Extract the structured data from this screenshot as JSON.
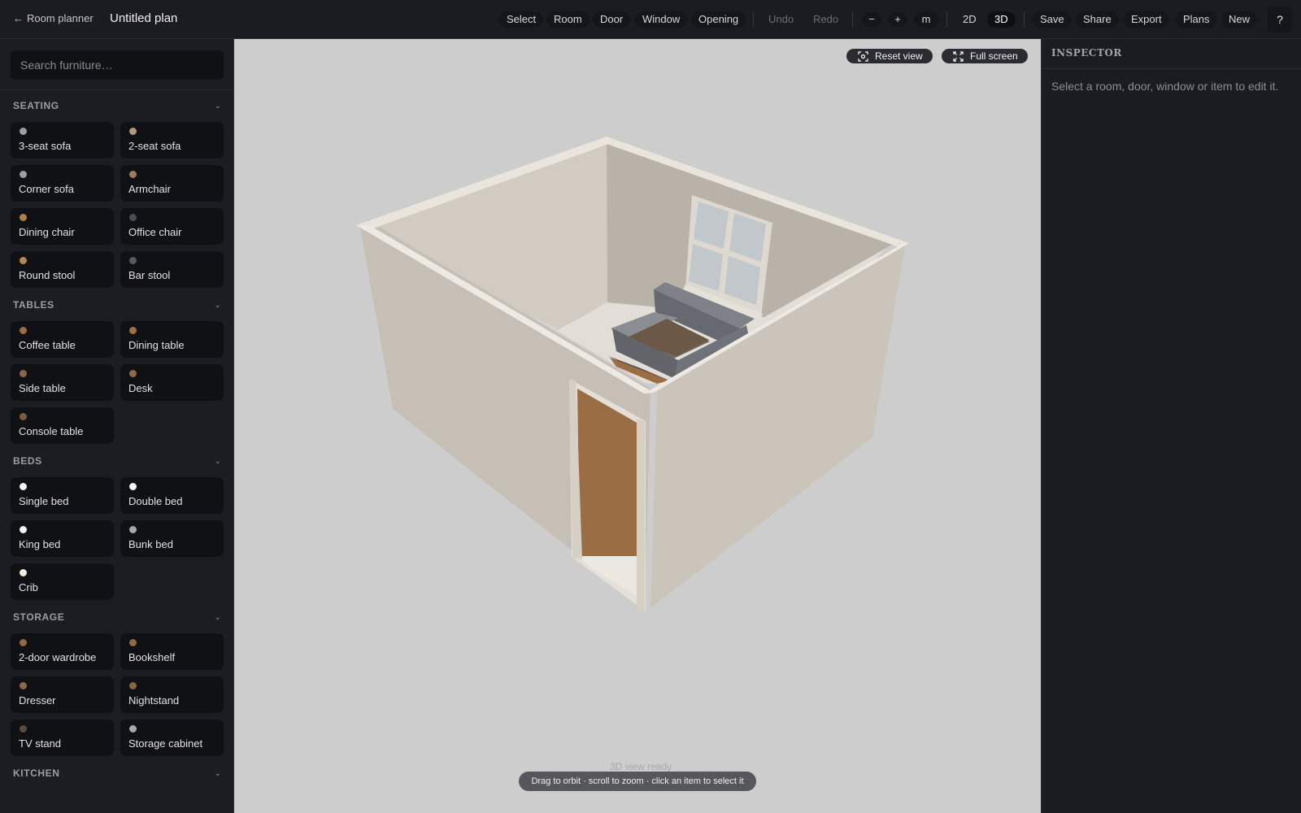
{
  "header": {
    "back_label": "Room planner",
    "plan_title": "Untitled plan"
  },
  "toolbar": {
    "tools": [
      "Select",
      "Room",
      "Door",
      "Window",
      "Opening"
    ],
    "undo": "Undo",
    "redo": "Redo",
    "zoom_out": "−",
    "zoom_in": "+",
    "unit": "m",
    "view_2d": "2D",
    "view_3d": "3D",
    "active_view": "3D",
    "save": "Save",
    "share": "Share",
    "export": "Export",
    "plans": "Plans",
    "new": "New",
    "help": "?"
  },
  "sidebar": {
    "search_placeholder": "Search furniture…",
    "categories": [
      {
        "label": "SEATING",
        "items": [
          {
            "label": "3-seat sofa",
            "color": "#9c9ea5"
          },
          {
            "label": "2-seat sofa",
            "color": "#b09880"
          },
          {
            "label": "Corner sofa",
            "color": "#9c9ea5"
          },
          {
            "label": "Armchair",
            "color": "#a07a62"
          },
          {
            "label": "Dining chair",
            "color": "#b07f48"
          },
          {
            "label": "Office chair",
            "color": "#4b4c52"
          },
          {
            "label": "Round stool",
            "color": "#b48750"
          },
          {
            "label": "Bar stool",
            "color": "#5a5b60"
          }
        ]
      },
      {
        "label": "TABLES",
        "items": [
          {
            "label": "Coffee table",
            "color": "#9b6e42"
          },
          {
            "label": "Dining table",
            "color": "#a2703f"
          },
          {
            "label": "Side table",
            "color": "#8a6844"
          },
          {
            "label": "Desk",
            "color": "#8e6c4a"
          },
          {
            "label": "Console table",
            "color": "#7c5b3c"
          }
        ]
      },
      {
        "label": "BEDS",
        "items": [
          {
            "label": "Single bed",
            "color": "#f4f4f4"
          },
          {
            "label": "Double bed",
            "color": "#f4f4f4"
          },
          {
            "label": "King bed",
            "color": "#f4f4f4"
          },
          {
            "label": "Bunk bed",
            "color": "#a7a8ad"
          },
          {
            "label": "Crib",
            "color": "#eeeae4"
          }
        ]
      },
      {
        "label": "STORAGE",
        "items": [
          {
            "label": "2-door wardrobe",
            "color": "#8f6a45"
          },
          {
            "label": "Bookshelf",
            "color": "#8d6a44"
          },
          {
            "label": "Dresser",
            "color": "#8c6846"
          },
          {
            "label": "Nightstand",
            "color": "#8a6541"
          },
          {
            "label": "TV stand",
            "color": "#5a4c3e"
          },
          {
            "label": "Storage cabinet",
            "color": "#a8a9ae"
          }
        ]
      },
      {
        "label": "KITCHEN",
        "items": []
      }
    ]
  },
  "canvas": {
    "reset_view": "Reset view",
    "full_screen": "Full screen",
    "status": "3D view ready",
    "hint": "Drag to orbit · scroll to zoom · click an item to select it"
  },
  "inspector": {
    "title": "INSPECTOR",
    "empty_message": "Select a room, door, window or item to edit it."
  },
  "colors": {
    "canvas_bg": "#cdcdce",
    "wall": "#c9c2b7",
    "door": "#9a6d44",
    "sofa": "#707279"
  }
}
